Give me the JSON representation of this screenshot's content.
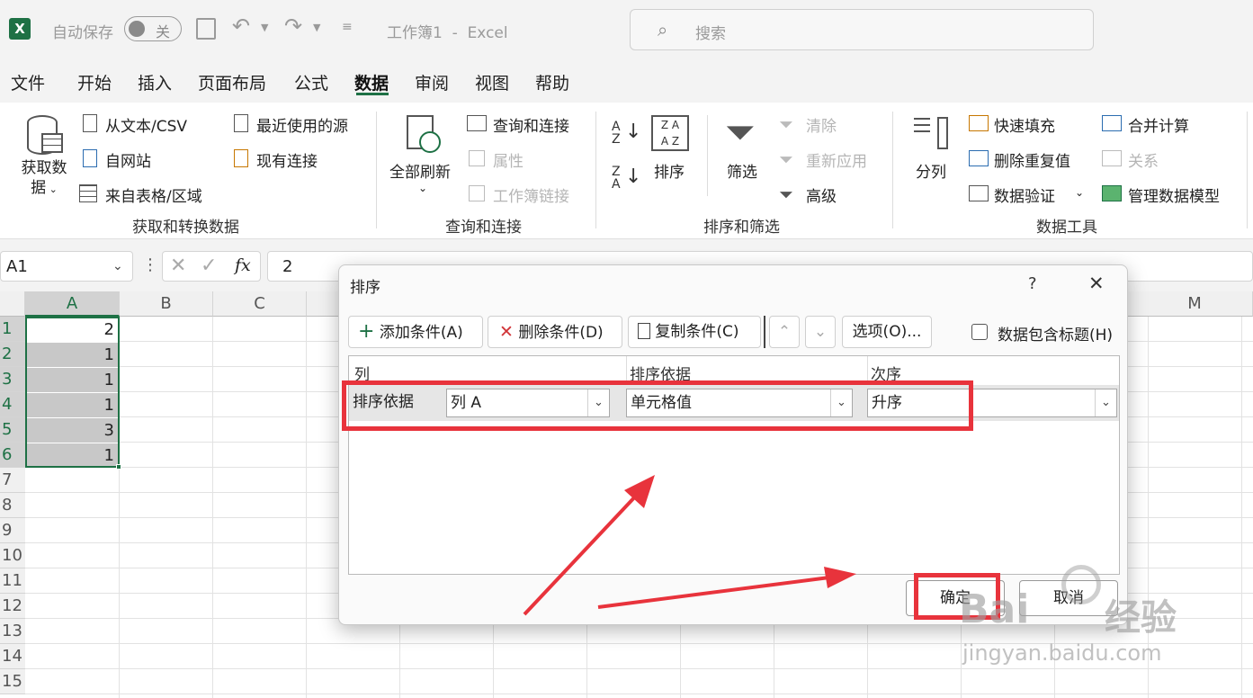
{
  "titlebar": {
    "autosave_label": "自动保存",
    "autosave_state": "关",
    "doc_title": "工作簿1  -  Excel",
    "search_placeholder": "搜索"
  },
  "tabs": [
    "文件",
    "开始",
    "插入",
    "页面布局",
    "公式",
    "数据",
    "审阅",
    "视图",
    "帮助"
  ],
  "active_tab": "数据",
  "ribbon": {
    "get_transform": {
      "big_button": "获取数\n据",
      "from_text": "从文本/CSV",
      "from_web": "自网站",
      "from_table": "来自表格/区域",
      "recent_sources": "最近使用的源",
      "existing_conn": "现有连接",
      "group_label": "获取和转换数据"
    },
    "queries": {
      "refresh_all": "全部刷新",
      "queries_conn": "查询和连接",
      "properties": "属性",
      "workbook_links": "工作簿链接",
      "group_label": "查询和连接"
    },
    "sort_filter": {
      "sort": "排序",
      "filter": "筛选",
      "clear": "清除",
      "reapply": "重新应用",
      "advanced": "高级",
      "group_label": "排序和筛选"
    },
    "data_tools": {
      "text_to_columns": "分列",
      "flash_fill": "快速填充",
      "remove_duplicates": "删除重复值",
      "data_validation": "数据验证",
      "consolidate": "合并计算",
      "relationships": "关系",
      "manage_model": "管理数据模型",
      "group_label": "数据工具"
    }
  },
  "formula_bar": {
    "name_box": "A1",
    "fx": "fx",
    "value": "2"
  },
  "grid": {
    "columns": [
      "A",
      "B",
      "C",
      "M"
    ],
    "rows": [
      "1",
      "2",
      "3",
      "4",
      "5",
      "6",
      "7",
      "8",
      "9",
      "10",
      "11",
      "12",
      "13",
      "14",
      "15"
    ],
    "col_a_values": [
      "2",
      "1",
      "1",
      "1",
      "3",
      "1"
    ]
  },
  "dialog": {
    "title": "排序",
    "help": "?",
    "close": "✕",
    "add_condition": "添加条件(A)",
    "delete_condition": "删除条件(D)",
    "copy_condition": "复制条件(C)",
    "options": "选项(O)...",
    "has_headers": "数据包含标题(H)",
    "header_col": "列",
    "header_sort_on": "排序依据",
    "header_order": "次序",
    "row_label": "排序依据",
    "column_value": "列 A",
    "sort_on_value": "单元格值",
    "order_value": "升序",
    "ok": "确定",
    "cancel": "取消"
  },
  "watermark": {
    "brand": "Bai",
    "brand2": "经验",
    "url": "jingyan.baidu.com"
  },
  "colors": {
    "excel_green": "#1e7145",
    "annotation_red": "#e8333c"
  }
}
